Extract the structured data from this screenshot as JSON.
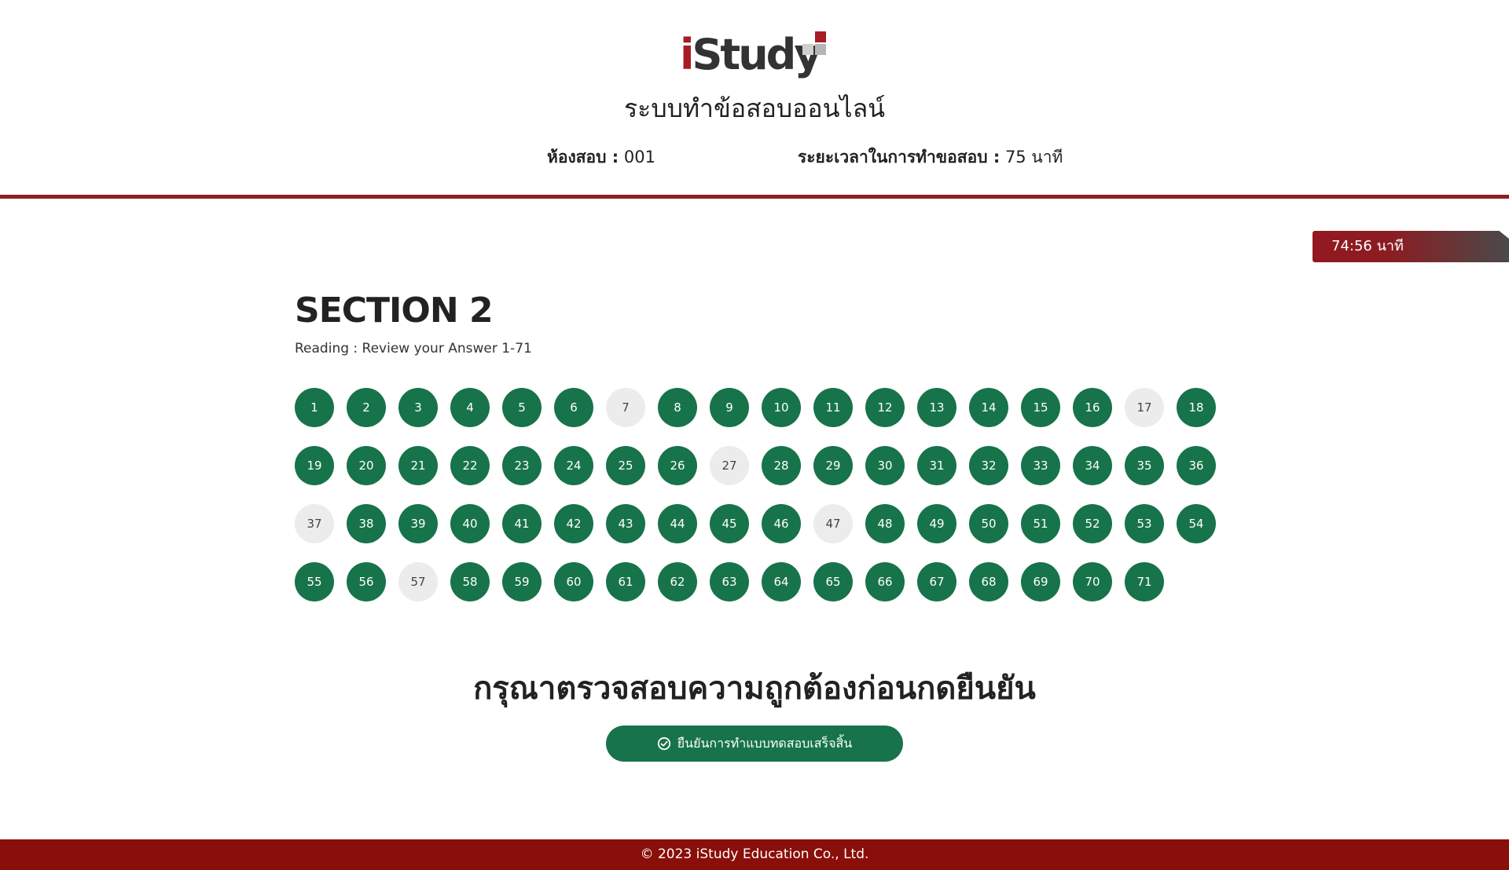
{
  "header": {
    "logo_text_i": "i",
    "logo_text_rest": "Study",
    "system_title": "ระบบทำข้อสอบออนไลน์",
    "room_label": "ห้องสอบ :",
    "room_value": "001",
    "duration_label": "ระยะเวลาในการทำขอสอบ :",
    "duration_value": "75 นาที"
  },
  "timer": {
    "text": "74:56 นาที"
  },
  "section": {
    "title": "SECTION 2",
    "subtitle": "Reading : Review your Answer 1-71"
  },
  "questions": {
    "per_row": 18,
    "total": 71,
    "unanswered": [
      7,
      17,
      27,
      37,
      47,
      57
    ],
    "colors": {
      "answered": "#17734a",
      "unanswered": "#ececec"
    }
  },
  "confirm": {
    "message": "กรุณาตรวจสอบความถูกต้องก่อนกดยืนยัน",
    "button_label": "ยืนยันการทำแบบทดสอบเสร็จสิ้น"
  },
  "footer": {
    "copyright": "© 2023 iStudy Education Co., Ltd."
  },
  "colors": {
    "brand_red": "#8a0e09",
    "brand_green": "#17734a"
  }
}
